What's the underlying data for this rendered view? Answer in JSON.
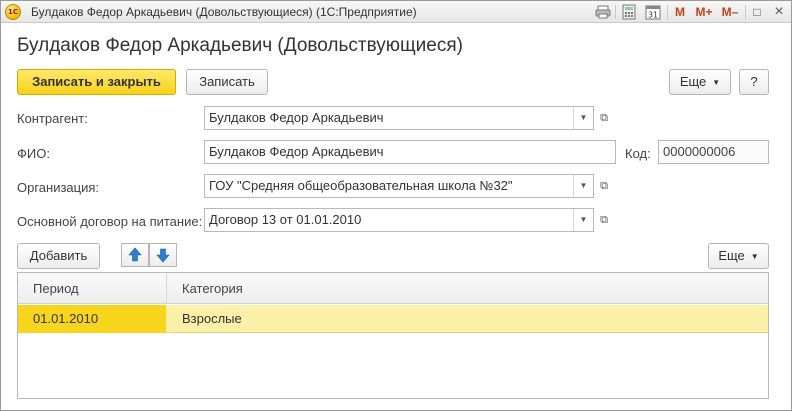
{
  "window": {
    "title": "Булдаков Федор Аркадьевич (Довольствующиеся)  (1С:Предприятие)",
    "logo_text": "1С",
    "controls": {
      "print_icon": "print-icon",
      "calc_icon": "calculator-icon",
      "calendar_icon": "calendar-icon",
      "m_label": "M",
      "m_plus_label": "M+",
      "m_minus_label": "M–",
      "restore_glyph": "□",
      "close_glyph": "×"
    }
  },
  "form": {
    "title": "Булдаков Федор Аркадьевич (Довольствующиеся)",
    "toolbar": {
      "save_close_label": "Записать и закрыть",
      "save_label": "Записать",
      "more_label": "Еще",
      "help_label": "?"
    },
    "fields": {
      "counterparty": {
        "label": "Контрагент:",
        "value": "Булдаков Федор Аркадьевич"
      },
      "fio": {
        "label": "ФИО:",
        "value": "Булдаков Федор Аркадьевич"
      },
      "code": {
        "label": "Код:",
        "value": "0000000006"
      },
      "organization": {
        "label": "Организация:",
        "value": "ГОУ \"Средняя общеобразовательная школа №32\""
      },
      "contract": {
        "label": "Основной договор на питание:",
        "value": "Договор 13 от 01.01.2010"
      }
    },
    "table_toolbar": {
      "add_label": "Добавить",
      "up_icon": "arrow-up-icon",
      "down_icon": "arrow-down-icon",
      "more_label": "Еще"
    },
    "table": {
      "columns": [
        "Период",
        "Категория"
      ],
      "rows": [
        {
          "period": "01.01.2010",
          "category": "Взрослые"
        }
      ]
    }
  },
  "colors": {
    "primary_button": "#f7d21a",
    "selected_row": "#fbf0a8",
    "selected_cell": "#f7d51c",
    "arrow_blue": "#2f7fd1"
  }
}
